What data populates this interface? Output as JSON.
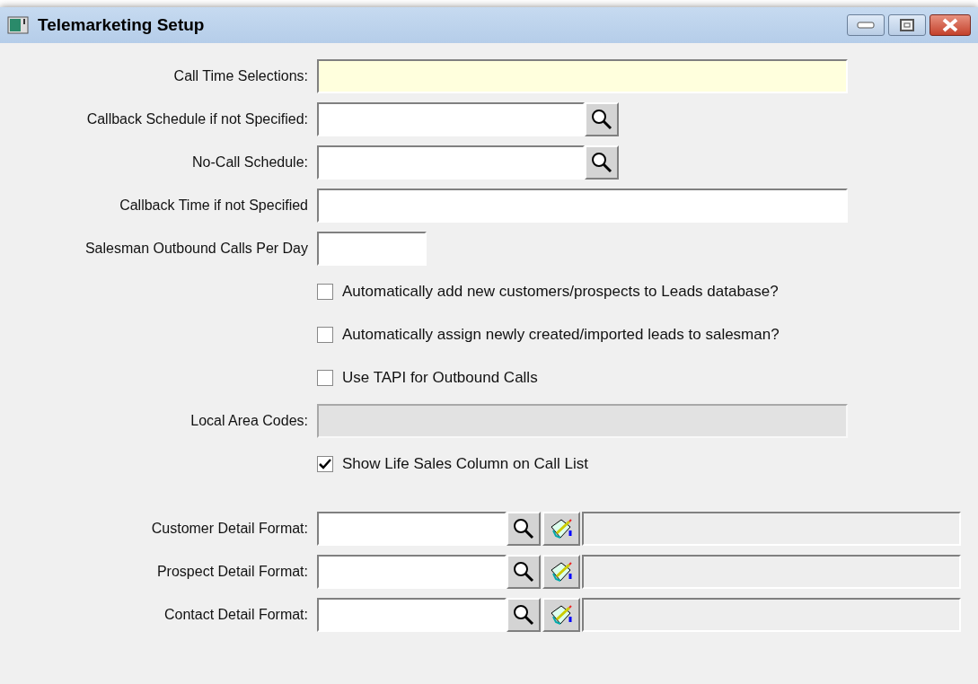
{
  "window": {
    "title": "Telemarketing Setup"
  },
  "rows": [
    {
      "kind": "field",
      "label": "Call Time Selections:",
      "highlighted": true,
      "disabled": false
    },
    {
      "kind": "lookup",
      "label": "Callback Schedule if not Specified:"
    },
    {
      "kind": "lookup",
      "label": "No-Call Schedule:"
    },
    {
      "kind": "field",
      "label": "Callback Time if not Specified",
      "highlighted": false,
      "disabled": false
    },
    {
      "kind": "short_field",
      "label": "Salesman Outbound Calls Per Day",
      "highlighted": false,
      "disabled": false
    },
    {
      "kind": "checkbox",
      "label": "Automatically add new customers/prospects to Leads database?",
      "checked": false
    },
    {
      "kind": "checkbox",
      "label": "Automatically assign newly created/imported leads to salesman?",
      "checked": false
    },
    {
      "kind": "checkbox",
      "label": "Use TAPI for Outbound Calls",
      "checked": false
    },
    {
      "kind": "field",
      "label": "Local Area Codes:",
      "highlighted": false,
      "disabled": true
    },
    {
      "kind": "checkbox",
      "label": "Show Life Sales Column on Call List",
      "checked": true
    },
    {
      "kind": "format",
      "label": "Customer Detail Format:"
    },
    {
      "kind": "format",
      "label": "Prospect Detail Format:"
    },
    {
      "kind": "format",
      "label": "Contact Detail Format:"
    }
  ]
}
